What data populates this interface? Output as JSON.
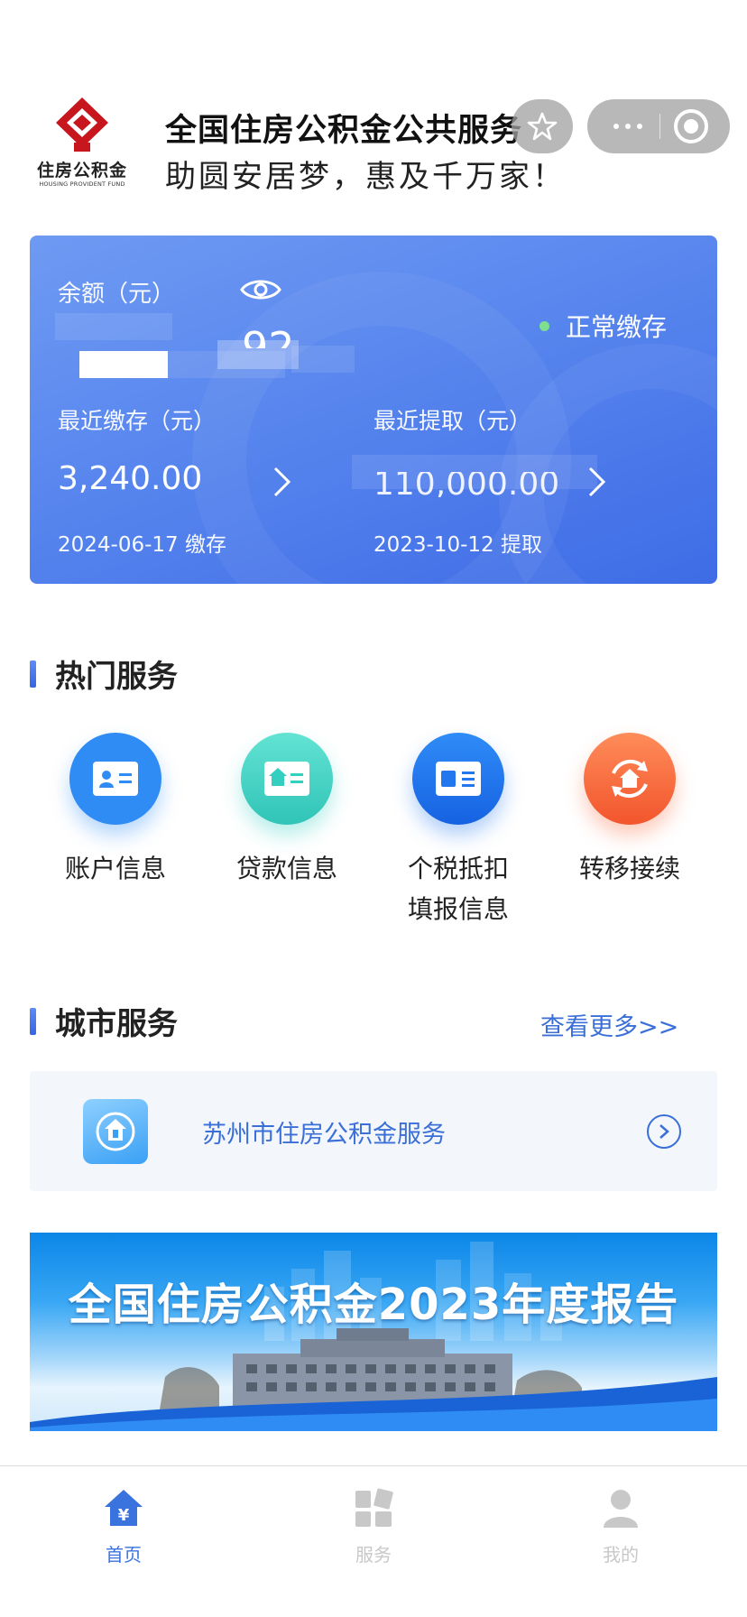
{
  "header": {
    "logo_cn": "住房公积金",
    "logo_en": "HOUSING PROVIDENT FUND",
    "title": "全国住房公积金公共服务",
    "slogan": "助圆安居梦，惠及千万家！"
  },
  "capsule": {
    "favorite_icon": "star-icon",
    "more_icon": "more-dots-icon",
    "close_icon": "target-close-icon"
  },
  "card": {
    "balance_label": "余额（元）",
    "balance_visible_text": "92",
    "status": "正常缴存",
    "recent_deposit_label": "最近缴存（元）",
    "recent_deposit_value": "3,240.00",
    "recent_deposit_date": "2024-06-17 缴存",
    "recent_withdraw_label": "最近提取（元）",
    "recent_withdraw_value": "110,000.00",
    "recent_withdraw_date": "2023-10-12 提取"
  },
  "hot_services": {
    "title": "热门服务",
    "items": [
      {
        "label": "账户信息",
        "icon": "account-card-icon",
        "color": "#2f8cf4"
      },
      {
        "label": "贷款信息",
        "icon": "loan-card-icon",
        "color": "#34cfc0"
      },
      {
        "label": "个税抵扣\n填报信息",
        "icon": "tax-card-icon",
        "color": "#2277ee"
      },
      {
        "label": "转移接续",
        "icon": "transfer-home-icon",
        "color": "#f86a3d"
      }
    ]
  },
  "city_services": {
    "title": "城市服务",
    "more": "查看更多>>",
    "item": "苏州市住房公积金服务"
  },
  "banner": {
    "title": "全国住房公积金2023年度报告"
  },
  "tabbar": {
    "items": [
      {
        "label": "首页",
        "icon": "home-yuan-icon",
        "active": true
      },
      {
        "label": "服务",
        "icon": "services-grid-icon",
        "active": false
      },
      {
        "label": "我的",
        "icon": "person-icon",
        "active": false
      }
    ],
    "active_color": "#3a72de",
    "inactive_color": "#c8c8c8"
  }
}
